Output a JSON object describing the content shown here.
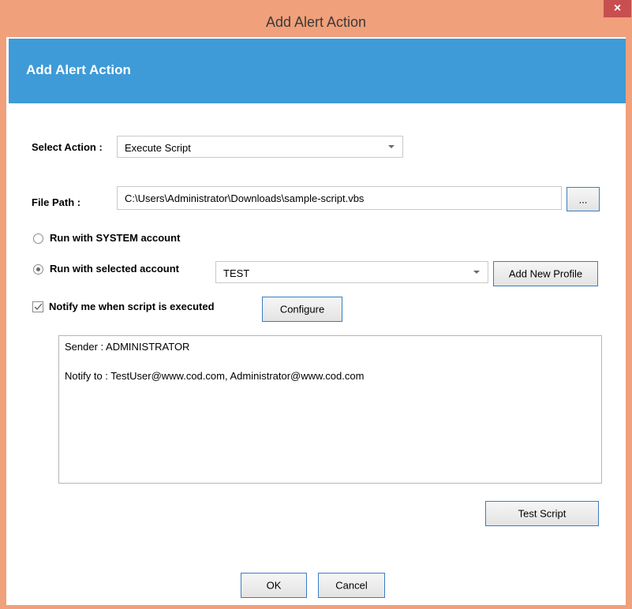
{
  "window": {
    "title": "Add Alert Action",
    "close_label": "×"
  },
  "header": {
    "title": "Add Alert Action"
  },
  "form": {
    "select_action_label": "Select Action :",
    "select_action_value": "Execute Script",
    "file_path_label": "File Path :",
    "file_path_value": "C:\\Users\\Administrator\\Downloads\\sample-script.vbs",
    "browse_label": "...",
    "radio_system_label": "Run with SYSTEM account",
    "radio_selected_label": "Run with selected account",
    "account_value": "TEST",
    "add_profile_label": "Add New Profile",
    "notify_label": "Notify me when script is executed",
    "notify_checked": true,
    "configure_label": "Configure",
    "sender_line": "Sender : ADMINISTRATOR",
    "notify_to_line": "Notify to : TestUser@www.cod.com, Administrator@www.cod.com",
    "test_script_label": "Test Script"
  },
  "footer": {
    "ok_label": "OK",
    "cancel_label": "Cancel"
  },
  "colors": {
    "frame": "#f0a07a",
    "header_band": "#3e9bd8",
    "close_button": "#c74f4f"
  }
}
